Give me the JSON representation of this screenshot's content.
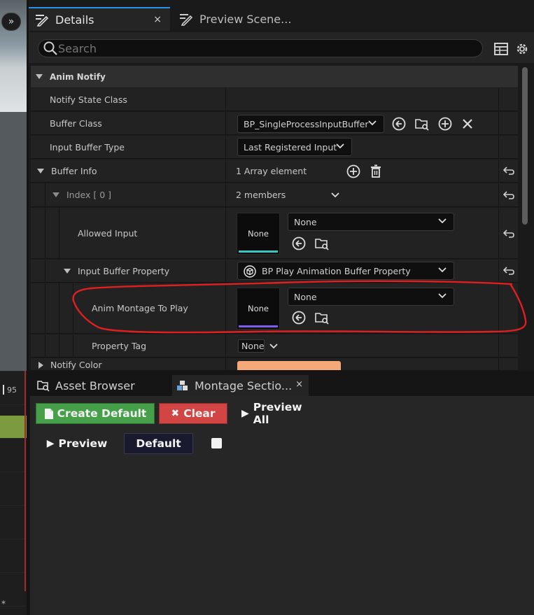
{
  "left_panel": {
    "collapse_glyph": "»"
  },
  "details": {
    "tabs": [
      {
        "label": "Details",
        "icon": "pencil-list-icon",
        "active": true,
        "close": "×"
      },
      {
        "label": "Preview Scene...",
        "icon": "pencil-list-icon",
        "active": false
      }
    ],
    "search_placeholder": "Search",
    "category": "Anim Notify",
    "rows": {
      "notify_state_class": "Notify State Class",
      "buffer_class": {
        "label": "Buffer Class",
        "value": "BP_SingleProcessInputBuffer"
      },
      "input_buffer_type": {
        "label": "Input Buffer Type",
        "value": "Last Registered Input"
      },
      "buffer_info": {
        "label": "Buffer Info",
        "value": "1 Array element"
      },
      "index": {
        "label": "Index [ 0 ]",
        "value": "2 members"
      },
      "allowed_input": {
        "label": "Allowed Input",
        "thumb": "None",
        "combo": "None"
      },
      "input_buffer_property": {
        "label": "Input Buffer Property",
        "value": "BP Play Animation Buffer Property"
      },
      "anim_montage": {
        "label": "Anim Montage To Play",
        "thumb": "None",
        "combo": "None"
      },
      "property_tag": {
        "label": "Property Tag",
        "value": "None"
      },
      "notify_color": {
        "label": "Notify Color"
      }
    },
    "colors": {
      "accent_tab": "#2b8fe6",
      "allowed_input_bar": "#37c8c4",
      "montage_bar": "#7a5de8",
      "notify_color_swatch": "#f5a878",
      "highlight_loop": "#e02020"
    }
  },
  "timeline": {
    "frame_number": "95",
    "marker": "*"
  },
  "bottom": {
    "tabs": [
      {
        "label": "Asset Browser",
        "icon": "asset-browser-icon"
      },
      {
        "label": "Montage Sectio...",
        "icon": "montage-sections-icon",
        "close": "×"
      }
    ],
    "buttons": {
      "create_default": "Create Default",
      "clear": "Clear",
      "preview_all": "Preview All",
      "preview": "Preview",
      "default": "Default"
    },
    "glyphs": {
      "clear": "✖",
      "play": "▶",
      "page": "▮"
    }
  }
}
